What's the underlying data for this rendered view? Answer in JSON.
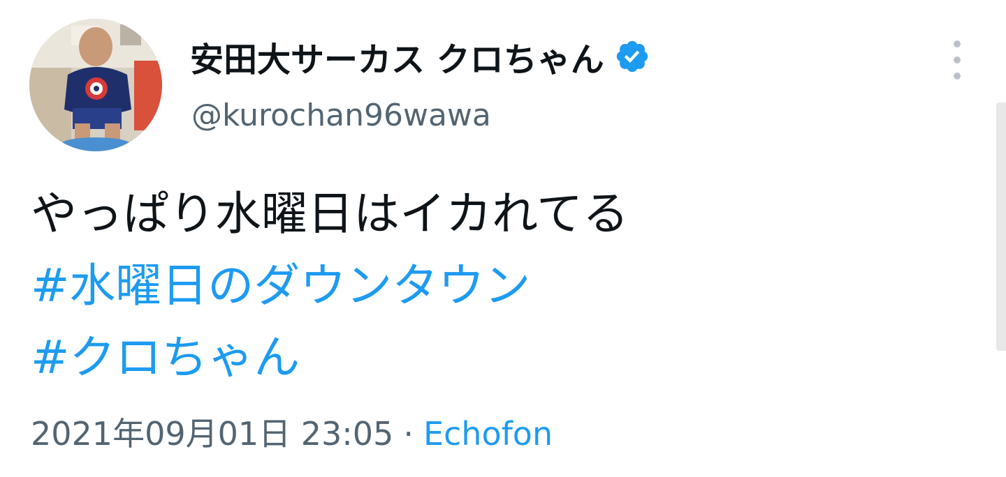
{
  "author": {
    "display_name": "安田大サーカス クロちゃん",
    "handle": "@kurochan96wawa",
    "verified": true,
    "avatar": "avatar-photo"
  },
  "tweet": {
    "text": "やっぱり水曜日はイカれてる",
    "hashtags": [
      "#水曜日のダウンタウン",
      "#クロちゃん"
    ],
    "timestamp": "2021年09月01日 23:05",
    "separator": "·",
    "source": "Echofon"
  },
  "icons": {
    "verified": "verified-badge-icon",
    "more": "more-vertical-icon"
  },
  "colors": {
    "link": "#1d9bf0",
    "secondary_text": "#536471",
    "primary_text": "#0f1419"
  }
}
